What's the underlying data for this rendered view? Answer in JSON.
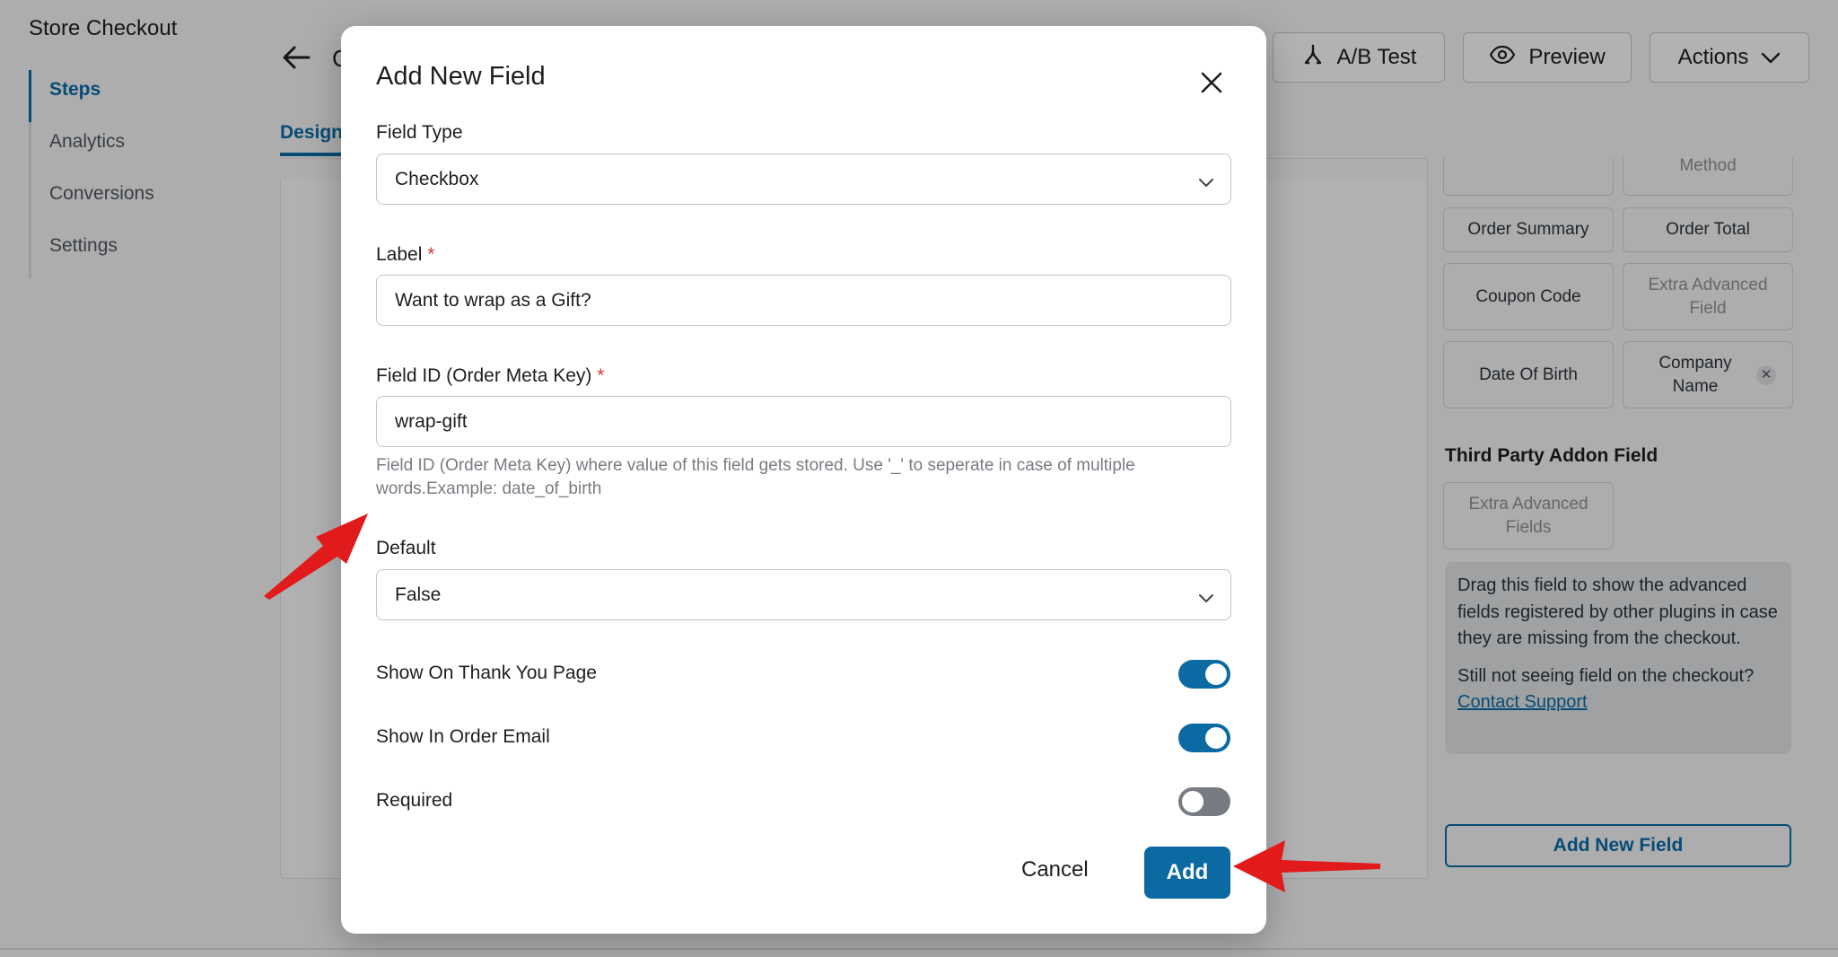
{
  "app": {
    "store_title": "Store Checkout",
    "page_title_fragment": "C"
  },
  "sidebar": {
    "items": [
      {
        "label": "Steps",
        "active": true
      },
      {
        "label": "Analytics"
      },
      {
        "label": "Conversions"
      },
      {
        "label": "Settings"
      }
    ]
  },
  "header": {
    "tab_design": "Design",
    "buttons": {
      "ab_test": "A/B Test",
      "preview": "Preview",
      "actions": "Actions"
    }
  },
  "right_panel": {
    "partial_chip": "Method",
    "fields": [
      {
        "label": "Order Summary"
      },
      {
        "label": "Order Total"
      },
      {
        "label": "Coupon Code"
      },
      {
        "label": "Extra Advanced Field",
        "disabled": true
      },
      {
        "label": "Date Of Birth"
      },
      {
        "label": "Company Name",
        "removable": true
      }
    ],
    "third_party_heading": "Third Party Addon Field",
    "third_party_chip": "Extra Advanced Fields",
    "info_text": "Drag this field to show the advanced fields registered by other plugins in case they are missing from the checkout.",
    "info_question": "Still not seeing field on the checkout?",
    "info_link": " Contact Support",
    "add_new_field": "Add New Field"
  },
  "modal": {
    "title": "Add New Field",
    "field_type": {
      "label": "Field Type",
      "value": "Checkbox"
    },
    "label_field": {
      "label": "Label",
      "required_mark": "*",
      "value": "Want to wrap as a Gift?"
    },
    "field_id": {
      "label": "Field ID (Order Meta Key)",
      "required_mark": "*",
      "value": "wrap-gift",
      "help": "Field ID (Order Meta Key) where value of this field gets stored. Use '_' to seperate in case of multiple words.Example: date_of_birth"
    },
    "default_field": {
      "label": "Default",
      "value": "False"
    },
    "toggles": [
      {
        "label": "Show On Thank You Page",
        "on": true
      },
      {
        "label": "Show In Order Email",
        "on": true
      },
      {
        "label": "Required",
        "on": false
      }
    ],
    "cancel": "Cancel",
    "add": "Add"
  },
  "colors": {
    "primary": "#0b6aa2",
    "required": "#d63638",
    "annotation_arrow": "#e11b1b"
  },
  "icons": [
    "back-arrow-icon",
    "ab-test-icon",
    "eye-icon",
    "chevron-down-icon",
    "close-icon"
  ]
}
